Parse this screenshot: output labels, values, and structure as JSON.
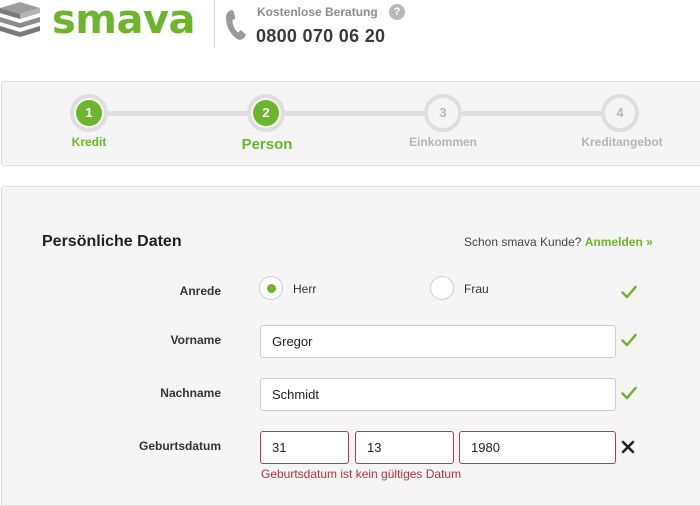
{
  "header": {
    "logo_text": "smava",
    "hotline_label": "Kostenlose Beratung",
    "help_symbol": "?",
    "hotline_number": "0800 070 06 20",
    "brand_color": "#6cb52d"
  },
  "stepper": {
    "steps": [
      {
        "number": "1",
        "label": "Kredit",
        "state": "done"
      },
      {
        "number": "2",
        "label": "Person",
        "state": "current"
      },
      {
        "number": "3",
        "label": "Einkommen",
        "state": "upcoming"
      },
      {
        "number": "4",
        "label": "Kreditangebot",
        "state": "upcoming"
      }
    ]
  },
  "form": {
    "title": "Persönliche Daten",
    "login_prompt": "Schon smava Kunde?",
    "login_link": "Anmelden »",
    "salutation": {
      "label": "Anrede",
      "options": [
        {
          "label": "Herr",
          "checked": true
        },
        {
          "label": "Frau",
          "checked": false
        }
      ],
      "status": "valid"
    },
    "first_name": {
      "label": "Vorname",
      "value": "Gregor",
      "status": "valid"
    },
    "last_name": {
      "label": "Nachname",
      "value": "Schmidt",
      "status": "valid"
    },
    "birth_date": {
      "label": "Geburtsdatum",
      "day": "31",
      "month": "13",
      "year": "1980",
      "status": "invalid",
      "error": "Geburtsdatum ist kein gültiges Datum"
    },
    "colors": {
      "valid": "#6cb52d",
      "error": "#b5343c"
    }
  }
}
